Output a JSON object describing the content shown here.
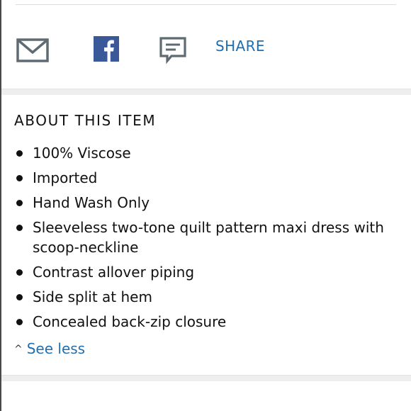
{
  "share": {
    "mail_icon": "mail-icon",
    "facebook_icon": "facebook-icon",
    "sms_icon": "message-icon",
    "label": "SHARE",
    "link_color": "#1f6fb0",
    "facebook_color": "#3b5998"
  },
  "about": {
    "title": "ABOUT THIS ITEM",
    "bullets": [
      "100% Viscose",
      "Imported",
      "Hand Wash Only",
      "Sleeveless two-tone quilt pattern maxi dress with scoop-neckline",
      "Contrast allover piping",
      "Side split at hem",
      "Concealed back-zip closure"
    ],
    "toggle_icon": "chevron-up-icon",
    "toggle_label": "See less"
  }
}
